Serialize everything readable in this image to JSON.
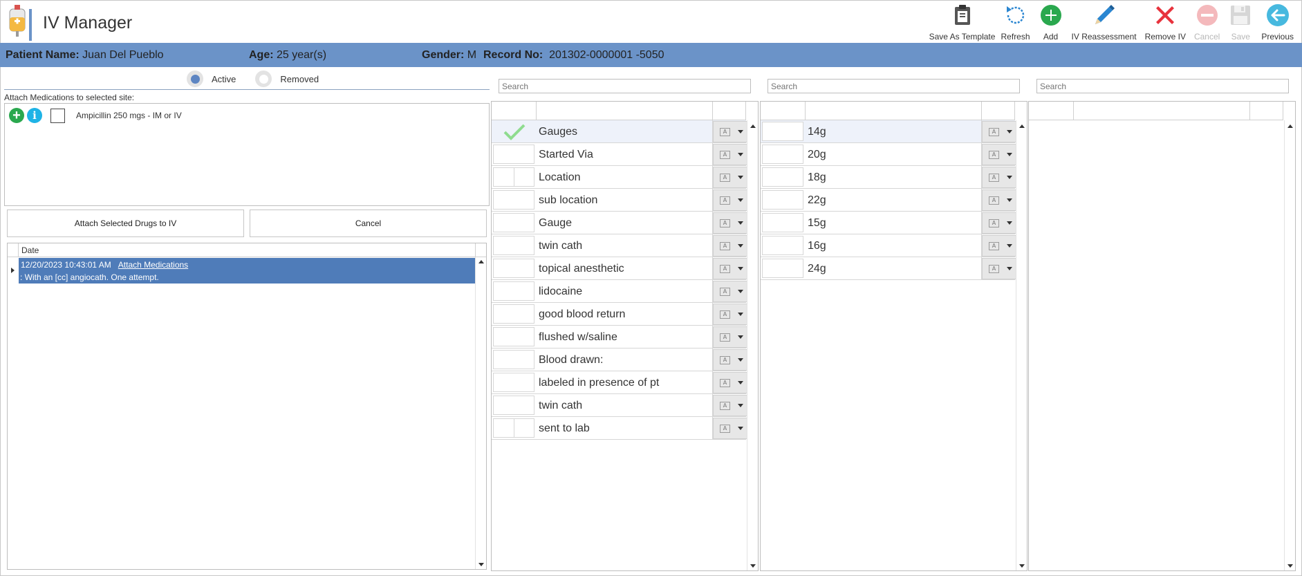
{
  "app": {
    "title": "IV Manager",
    "logo_icon": "iv-bag-icon"
  },
  "toolbar": [
    {
      "name": "save-as-template-button",
      "icon": "clipboard-icon",
      "label": "Save As Template",
      "enabled": true
    },
    {
      "name": "refresh-button",
      "icon": "refresh-icon",
      "label": "Refresh",
      "enabled": true
    },
    {
      "name": "add-button",
      "icon": "plus-circle-icon",
      "label": "Add",
      "enabled": true
    },
    {
      "name": "iv-reassessment-button",
      "icon": "pencil-icon",
      "label": "IV Reassessment",
      "enabled": true
    },
    {
      "name": "remove-iv-button",
      "icon": "x-icon",
      "label": "Remove IV",
      "enabled": true
    },
    {
      "name": "cancel-toolbar-button",
      "icon": "minus-circle-icon",
      "label": "Cancel",
      "enabled": false
    },
    {
      "name": "save-button",
      "icon": "floppy-icon",
      "label": "Save",
      "enabled": false
    },
    {
      "name": "previous-button",
      "icon": "arrow-left-circle-icon",
      "label": "Previous",
      "enabled": true
    }
  ],
  "colors": {
    "header_bar": "#6b93c8",
    "selected_row": "#4f7cb9",
    "add": "#2aa84e",
    "remove": "#e8323c",
    "info": "#1eb3e6"
  },
  "patient": {
    "name_label": "Patient Name:",
    "name": "Juan Del Pueblo",
    "age_label": "Age:",
    "age": "25 year(s)",
    "gender_label": "Gender:",
    "gender": "M",
    "record_label": "Record No:",
    "record": "201302-0000001 -5050"
  },
  "status_filter": {
    "active_label": "Active",
    "removed_label": "Removed",
    "selected": "Active"
  },
  "attach": {
    "caption": "Attach Medications to selected site:",
    "medications": [
      {
        "name": "Ampicillin 250 mgs - IM or IV",
        "checked": false
      }
    ],
    "attach_button": "Attach Selected Drugs to IV",
    "cancel_button": "Cancel"
  },
  "history": {
    "column": "Date",
    "rows": [
      {
        "date": "12/20/2023 10:43:01 AM",
        "action": "Attach Medications",
        "note": ": With an [cc] angiocath. One attempt."
      }
    ]
  },
  "search": {
    "placeholder": "Search"
  },
  "grid1": {
    "rows": [
      {
        "label": "Gauges",
        "checked": true,
        "selected": true
      },
      {
        "label": "Started Via",
        "checked": false
      },
      {
        "label": "Location",
        "checked": false,
        "split": true
      },
      {
        "label": "sub location",
        "checked": false
      },
      {
        "label": "Gauge",
        "checked": false
      },
      {
        "label": "twin cath",
        "checked": false
      },
      {
        "label": "topical anesthetic",
        "checked": false
      },
      {
        "label": "lidocaine",
        "checked": false
      },
      {
        "label": "good blood return",
        "checked": false
      },
      {
        "label": "flushed w/saline",
        "checked": false
      },
      {
        "label": "Blood drawn:",
        "checked": false
      },
      {
        "label": "labeled in presence of pt",
        "checked": false
      },
      {
        "label": "twin cath",
        "checked": false
      },
      {
        "label": "sent to lab",
        "checked": false,
        "split": true
      }
    ]
  },
  "grid2": {
    "rows": [
      {
        "label": "14g",
        "selected": true
      },
      {
        "label": "20g"
      },
      {
        "label": "18g"
      },
      {
        "label": "22g"
      },
      {
        "label": "15g"
      },
      {
        "label": "16g"
      },
      {
        "label": "24g"
      }
    ]
  },
  "grid3": {
    "rows": []
  }
}
